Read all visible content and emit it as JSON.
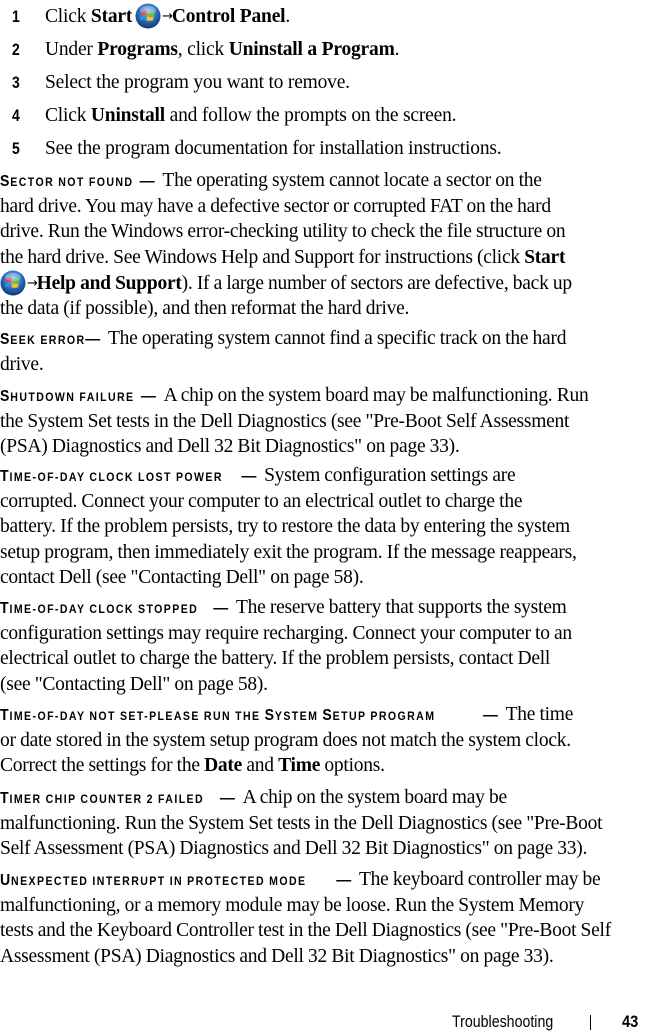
{
  "steps": [
    {
      "number": "1",
      "pre": "Click ",
      "bold1": "Start",
      "icon": "windows-start-orb-icon",
      "arrow": "→",
      "bold2": "Control Panel",
      "post": "."
    },
    {
      "number": "2",
      "pre": "Under ",
      "bold1": "Programs",
      "mid": ", click ",
      "bold2": "Uninstall a Program",
      "post": "."
    },
    {
      "number": "3",
      "text": "Select the program you want to remove."
    },
    {
      "number": "4",
      "pre": "Click ",
      "bold1": "Uninstall",
      "post": " and follow the prompts on the screen."
    },
    {
      "number": "5",
      "text": "See the program documentation for installation instructions."
    }
  ],
  "entries": [
    {
      "term": "Sector not found",
      "dash": "—",
      "lines": [
        "The operating system cannot locate a sector on the",
        "hard drive. You may have a defective sector or corrupted FAT on the hard",
        "drive. Run the Windows error-checking utility to check the file structure on",
        "the hard drive. See Windows Help and Support for instructions (click "
      ],
      "line4_bold": "Start",
      "line5_arrow": "→",
      "line5_bold": "Help and Support",
      "line5_rest": "). If a large number of sectors are defective, back up",
      "line6": "the data (if possible), and then reformat the hard drive."
    },
    {
      "term": "Seek error",
      "dash": "—",
      "lines": [
        "The operating system cannot find a specific track on the hard",
        "drive."
      ]
    },
    {
      "term": "Shutdown failure",
      "dash": "—",
      "lines": [
        "A chip on the system board may be malfunctioning. Run",
        "the System Set tests in the Dell Diagnostics (see \"Pre-Boot Self Assessment",
        "(PSA) Diagnostics and Dell 32 Bit Diagnostics\" on page 33)."
      ]
    },
    {
      "term": "Time-of-day clock lost power",
      "dash": "—",
      "lines": [
        "System configuration settings are",
        "corrupted. Connect your computer to an electrical outlet to charge the",
        "battery. If the problem persists, try to restore the data by entering the system",
        "setup program, then immediately exit the program. If the message reappears,",
        "contact Dell (see \"Contacting Dell\" on page 58)."
      ]
    },
    {
      "term": "Time-of-day clock stopped",
      "dash": "—",
      "lines": [
        "The reserve battery that supports the system",
        "configuration settings may require recharging. Connect your computer to an",
        "electrical outlet to charge the battery. If the problem persists, contact Dell",
        "(see \"Contacting Dell\" on page 58)."
      ]
    },
    {
      "term": "Time-of-day not set-please run the System Setup program",
      "dash": "—",
      "lines": [
        "The time",
        "or date stored in the system setup program does not match the system clock."
      ],
      "line3_pre": "Correct the settings for the ",
      "line3_bold1": "Date",
      "line3_mid": " and ",
      "line3_bold2": "Time",
      "line3_post": " options."
    },
    {
      "term": "Timer chip counter 2 failed",
      "dash": "—",
      "lines": [
        "A chip on the system board may be",
        "malfunctioning. Run the System Set tests in the Dell Diagnostics (see \"Pre-Boot",
        "Self Assessment (PSA) Diagnostics and Dell 32 Bit Diagnostics\" on page 33)."
      ]
    },
    {
      "term": "Unexpected interrupt in protected mode",
      "dash": "—",
      "lines": [
        "The keyboard controller may be",
        "malfunctioning, or a memory module may be loose. Run the System Memory",
        "tests and the Keyboard Controller test in the Dell Diagnostics (see \"Pre-Boot Self",
        "Assessment (PSA) Diagnostics and Dell 32 Bit Diagnostics\" on page 33)."
      ]
    }
  ],
  "footer": {
    "section": "Troubleshooting",
    "page_number": "43"
  },
  "colors": {
    "text": "#000000",
    "background": "#ffffff",
    "orb_blue": "#2a6fc0",
    "logo_red": "#e8452c",
    "logo_green": "#6fbf3b",
    "logo_blue": "#2f8fe0",
    "logo_yellow": "#f7c21a"
  }
}
